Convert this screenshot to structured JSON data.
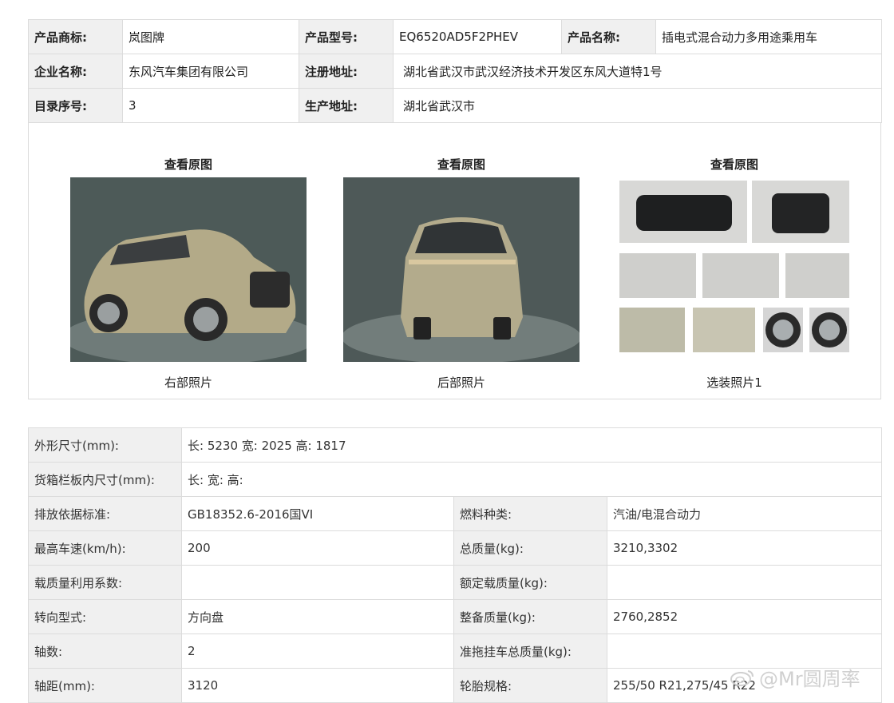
{
  "basic": {
    "brand_label": "产品商标:",
    "brand": "岚图牌",
    "model_label": "产品型号:",
    "model": "EQ6520AD5F2PHEV",
    "name_label": "产品名称:",
    "name": "插电式混合动力多用途乘用车",
    "company_label": "企业名称:",
    "company": "东风汽车集团有限公司",
    "reg_addr_label": "注册地址:",
    "reg_addr": "湖北省武汉市武汉经济技术开发区东风大道特1号",
    "catalog_label": "目录序号:",
    "catalog": "3",
    "prod_addr_label": "生产地址:",
    "prod_addr": "湖北省武汉市"
  },
  "photos": [
    {
      "link": "查看原图",
      "caption": "右部照片"
    },
    {
      "link": "查看原图",
      "caption": "后部照片"
    },
    {
      "link": "查看原图",
      "caption": "选装照片1"
    }
  ],
  "specs": {
    "dims_label": "外形尺寸(mm):",
    "dims": "长: 5230 宽: 2025 高: 1817",
    "cargo_label": "货箱栏板内尺寸(mm):",
    "cargo": "长:  宽:  高:",
    "emission_label": "排放依据标准:",
    "emission": "GB18352.6-2016国VI",
    "fuel_label": "燃料种类:",
    "fuel": "汽油/电混合动力",
    "speed_label": "最高车速(km/h):",
    "speed": "200",
    "total_mass_label": "总质量(kg):",
    "total_mass": "3210,3302",
    "load_coef_label": "载质量利用系数:",
    "load_coef": "",
    "rated_load_label": "额定载质量(kg):",
    "rated_load": "",
    "steering_label": "转向型式:",
    "steering": "方向盘",
    "curb_label": "整备质量(kg):",
    "curb": "2760,2852",
    "axles_label": "轴数:",
    "axles": "2",
    "trailer_label": "准拖挂车总质量(kg):",
    "trailer": "",
    "wheelbase_label": "轴距(mm):",
    "wheelbase": "3120",
    "tire_label": "轮胎规格:",
    "tire": "255/50 R21,275/45 R22"
  },
  "watermark": "@Mr圆周率"
}
